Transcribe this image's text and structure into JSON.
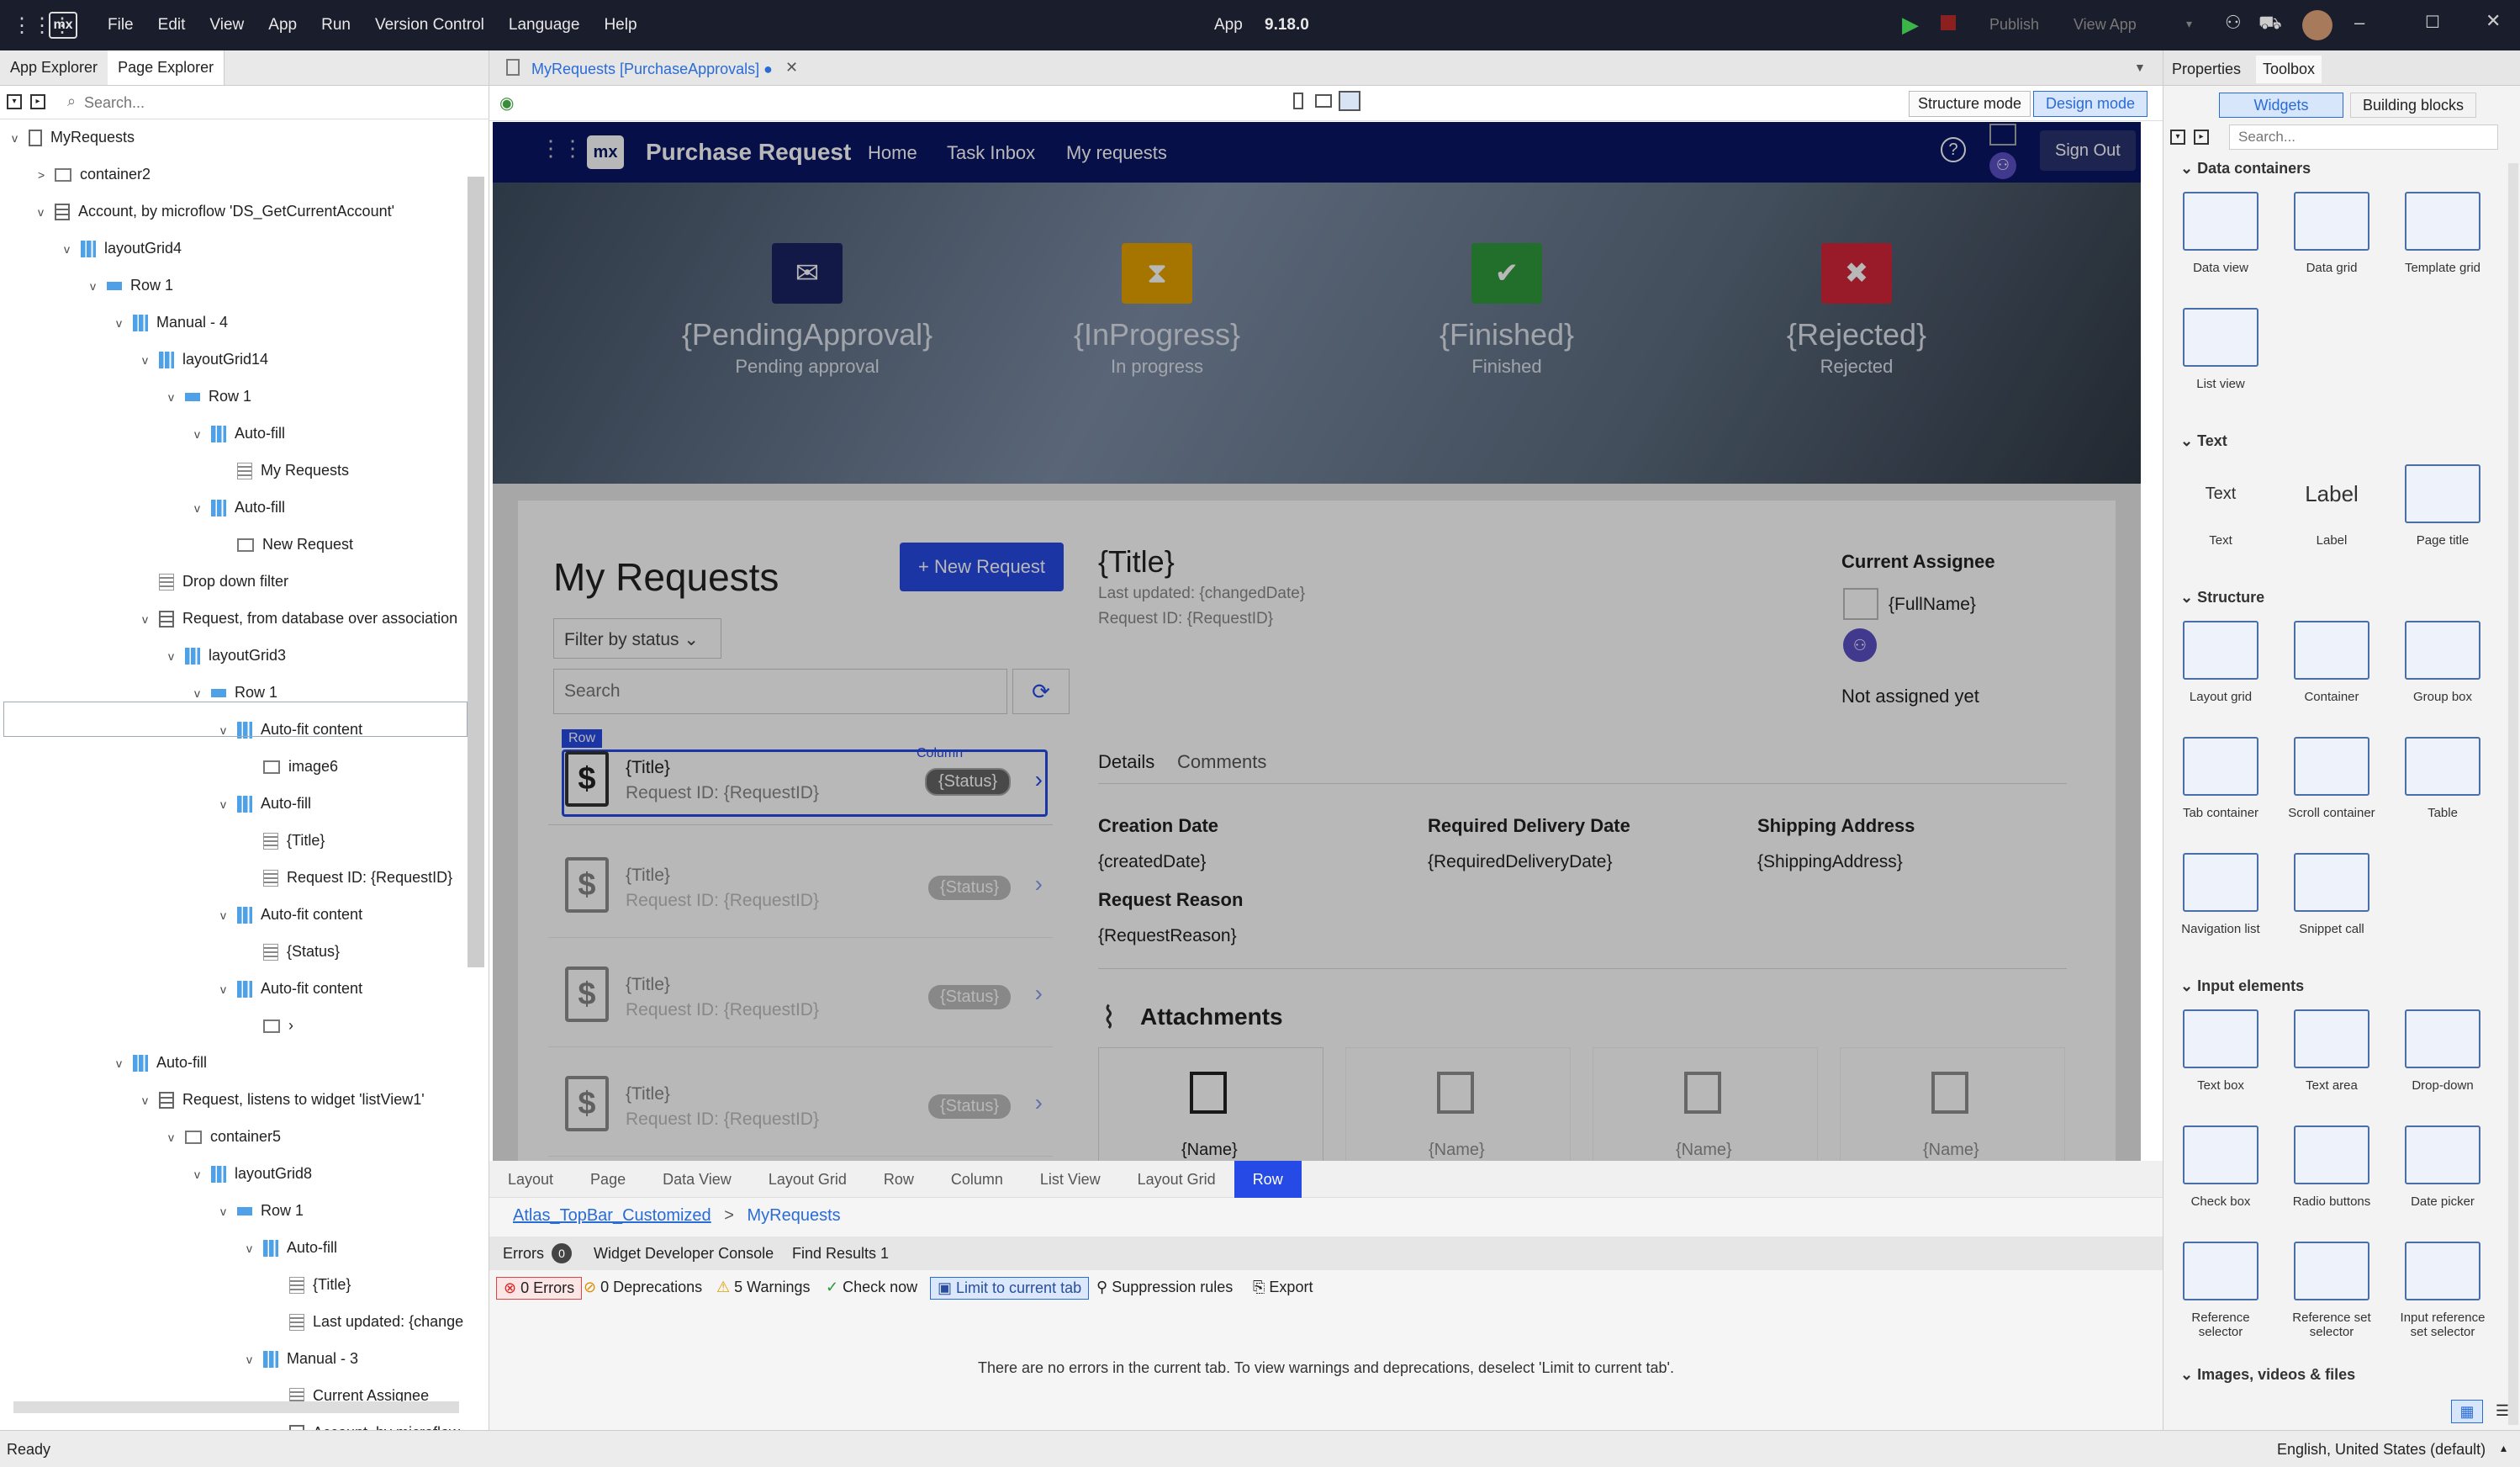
{
  "titlebar": {
    "logo": "mx",
    "menu": [
      "File",
      "Edit",
      "View",
      "App",
      "Run",
      "Version Control",
      "Language",
      "Help"
    ],
    "app_title": "App",
    "version": "9.18.0",
    "publish": "Publish",
    "view_app": "View App"
  },
  "left_panel": {
    "tabs": [
      "App Explorer",
      "Page Explorer"
    ],
    "search_placeholder": "Search...",
    "tree": [
      {
        "label": "MyRequests",
        "indent": 0,
        "icon": "page-icon",
        "expand": "v"
      },
      {
        "label": "container2",
        "indent": 1,
        "icon": "container-icon",
        "expand": ">"
      },
      {
        "label": "Account, by microflow 'DS_GetCurrentAccount'",
        "indent": 1,
        "icon": "dataview-icon",
        "expand": "v"
      },
      {
        "label": "layoutGrid4",
        "indent": 2,
        "icon": "layout-grid-icon",
        "expand": "v"
      },
      {
        "label": "Row 1",
        "indent": 3,
        "icon": "row-icon",
        "expand": "v"
      },
      {
        "label": "Manual - 4",
        "indent": 4,
        "icon": "layout-grid-icon",
        "expand": "v"
      },
      {
        "label": "layoutGrid14",
        "indent": 5,
        "icon": "layout-grid-icon",
        "expand": "v"
      },
      {
        "label": "Row 1",
        "indent": 6,
        "icon": "row-icon",
        "expand": "v"
      },
      {
        "label": "Auto-fill",
        "indent": 7,
        "icon": "layout-grid-icon",
        "expand": "v"
      },
      {
        "label": "My Requests",
        "indent": 8,
        "icon": "text-icon",
        "expand": ""
      },
      {
        "label": "Auto-fill",
        "indent": 7,
        "icon": "layout-grid-icon",
        "expand": "v"
      },
      {
        "label": "New Request",
        "indent": 8,
        "icon": "button-icon",
        "expand": ""
      },
      {
        "label": "Drop down filter",
        "indent": 5,
        "icon": "filter-icon",
        "expand": ""
      },
      {
        "label": "Request, from database over association",
        "indent": 5,
        "icon": "dataview-icon",
        "expand": "v"
      },
      {
        "label": "layoutGrid3",
        "indent": 6,
        "icon": "layout-grid-icon",
        "expand": "v"
      },
      {
        "label": "Row 1",
        "indent": 7,
        "icon": "row-icon",
        "expand": "v"
      },
      {
        "label": "Auto-fit content",
        "indent": 8,
        "icon": "layout-grid-icon",
        "expand": "v"
      },
      {
        "label": "image6",
        "indent": 9,
        "icon": "image-icon",
        "expand": ""
      },
      {
        "label": "Auto-fill",
        "indent": 8,
        "icon": "layout-grid-icon",
        "expand": "v"
      },
      {
        "label": "{Title}",
        "indent": 9,
        "icon": "text-icon",
        "expand": ""
      },
      {
        "label": "Request ID: {RequestID}",
        "indent": 9,
        "icon": "text-icon",
        "expand": ""
      },
      {
        "label": "Auto-fit content",
        "indent": 8,
        "icon": "layout-grid-icon",
        "expand": "v"
      },
      {
        "label": "{Status}",
        "indent": 9,
        "icon": "text-icon",
        "expand": ""
      },
      {
        "label": "Auto-fit content",
        "indent": 8,
        "icon": "layout-grid-icon",
        "expand": "v"
      },
      {
        "label": "›",
        "indent": 9,
        "icon": "button-icon",
        "expand": ""
      },
      {
        "label": "Auto-fill",
        "indent": 4,
        "icon": "layout-grid-icon",
        "expand": "v"
      },
      {
        "label": "Request, listens to widget 'listView1'",
        "indent": 5,
        "icon": "dataview-icon",
        "expand": "v"
      },
      {
        "label": "container5",
        "indent": 6,
        "icon": "container-icon",
        "expand": "v"
      },
      {
        "label": "layoutGrid8",
        "indent": 7,
        "icon": "layout-grid-icon",
        "expand": "v"
      },
      {
        "label": "Row 1",
        "indent": 8,
        "icon": "row-icon",
        "expand": "v"
      },
      {
        "label": "Auto-fill",
        "indent": 9,
        "icon": "layout-grid-icon",
        "expand": "v"
      },
      {
        "label": "{Title}",
        "indent": 10,
        "icon": "text-icon",
        "expand": ""
      },
      {
        "label": "Last updated: {change",
        "indent": 10,
        "icon": "text-icon",
        "expand": ""
      },
      {
        "label": "Manual - 3",
        "indent": 9,
        "icon": "layout-grid-icon",
        "expand": "v"
      },
      {
        "label": "Current Assignee",
        "indent": 10,
        "icon": "text-icon",
        "expand": ""
      },
      {
        "label": "Account, by microflow",
        "indent": 10,
        "icon": "dataview-icon",
        "expand": "v"
      }
    ]
  },
  "document": {
    "tab_label": "MyRequests [PurchaseApprovals]",
    "modes": [
      "Structure mode",
      "Design mode"
    ]
  },
  "app_page": {
    "logo": "mx",
    "brand": "Purchase Request",
    "nav": [
      "Home",
      "Task Inbox",
      "My requests"
    ],
    "sign_out": "Sign Out",
    "stats": [
      {
        "value": "{PendingApproval}",
        "label": "Pending approval",
        "color": "#1a2363",
        "icon": "✉"
      },
      {
        "value": "{InProgress}",
        "label": "In progress",
        "color": "#e5a200",
        "icon": "⧗"
      },
      {
        "value": "{Finished}",
        "label": "Finished",
        "color": "#2f9a3c",
        "icon": "✔"
      },
      {
        "value": "{Rejected}",
        "label": "Rejected",
        "color": "#d5263a",
        "icon": "✖"
      }
    ],
    "my_requests_title": "My Requests",
    "new_request": "New Request",
    "filter": "Filter by status",
    "search_placeholder": "Search",
    "row_tag": "Row",
    "column_tag": "Column",
    "list_items": [
      {
        "title": "{Title}",
        "id": "Request ID: {RequestID}",
        "status": "{Status}"
      },
      {
        "title": "{Title}",
        "id": "Request ID: {RequestID}",
        "status": "{Status}"
      },
      {
        "title": "{Title}",
        "id": "Request ID: {RequestID}",
        "status": "{Status}"
      },
      {
        "title": "{Title}",
        "id": "Request ID: {RequestID}",
        "status": "{Status}"
      }
    ],
    "detail": {
      "title": "{Title}",
      "last_updated": "Last updated: {changedDate}",
      "request_id": "Request ID: {RequestID}",
      "current_assignee": "Current Assignee",
      "full_name": "{FullName}",
      "not_assigned": "Not assigned yet",
      "tabs": [
        "Details",
        "Comments"
      ],
      "fields": [
        {
          "label": "Creation Date",
          "value": "{createdDate}"
        },
        {
          "label": "Required Delivery Date",
          "value": "{RequiredDeliveryDate}"
        },
        {
          "label": "Shipping Address",
          "value": "{ShippingAddress}"
        }
      ],
      "reason_label": "Request Reason",
      "reason_value": "{RequestReason}",
      "attachments": "Attachments",
      "attachment_names": [
        "{Name}",
        "{Name}",
        "{Name}",
        "{Name}"
      ]
    }
  },
  "breadcrumb": [
    "Layout",
    "Page",
    "Data View",
    "Layout Grid",
    "Row",
    "Column",
    "List View",
    "Layout Grid",
    "Row"
  ],
  "path": {
    "layout": "Atlas_TopBar_Customized",
    "separator": ">",
    "page": "MyRequests"
  },
  "errors_panel": {
    "tabs": [
      "Errors",
      "Widget Developer Console",
      "Find Results 1"
    ],
    "error_count": "0",
    "filters": [
      "0 Errors",
      "0 Deprecations",
      "5 Warnings",
      "Check now",
      "Limit to current tab",
      "Suppression rules",
      "Export"
    ],
    "message": "There are no errors in the current tab. To view warnings and deprecations, deselect 'Limit to current tab'."
  },
  "right_panel": {
    "tabs": [
      "Properties",
      "Toolbox"
    ],
    "subtabs": [
      "Widgets",
      "Building blocks"
    ],
    "search_placeholder": "Search...",
    "sections": [
      {
        "title": "Data containers",
        "items": [
          "Data view",
          "Data grid",
          "Template grid",
          "List view"
        ]
      },
      {
        "title": "Text",
        "items": [
          "Text",
          "Label",
          "Page title"
        ]
      },
      {
        "title": "Structure",
        "items": [
          "Layout grid",
          "Container",
          "Group box",
          "Tab container",
          "Scroll container",
          "Table",
          "Navigation list",
          "Snippet call"
        ]
      },
      {
        "title": "Input elements",
        "items": [
          "Text box",
          "Text area",
          "Drop-down",
          "Check box",
          "Radio buttons",
          "Date picker",
          "Reference selector",
          "Reference set selector",
          "Input reference set selector"
        ]
      },
      {
        "title": "Images, videos & files",
        "items": []
      }
    ],
    "text_previews": {
      "text": "Text",
      "label": "Label"
    }
  },
  "status": {
    "left": "Ready",
    "right": "English, United States (default)"
  }
}
